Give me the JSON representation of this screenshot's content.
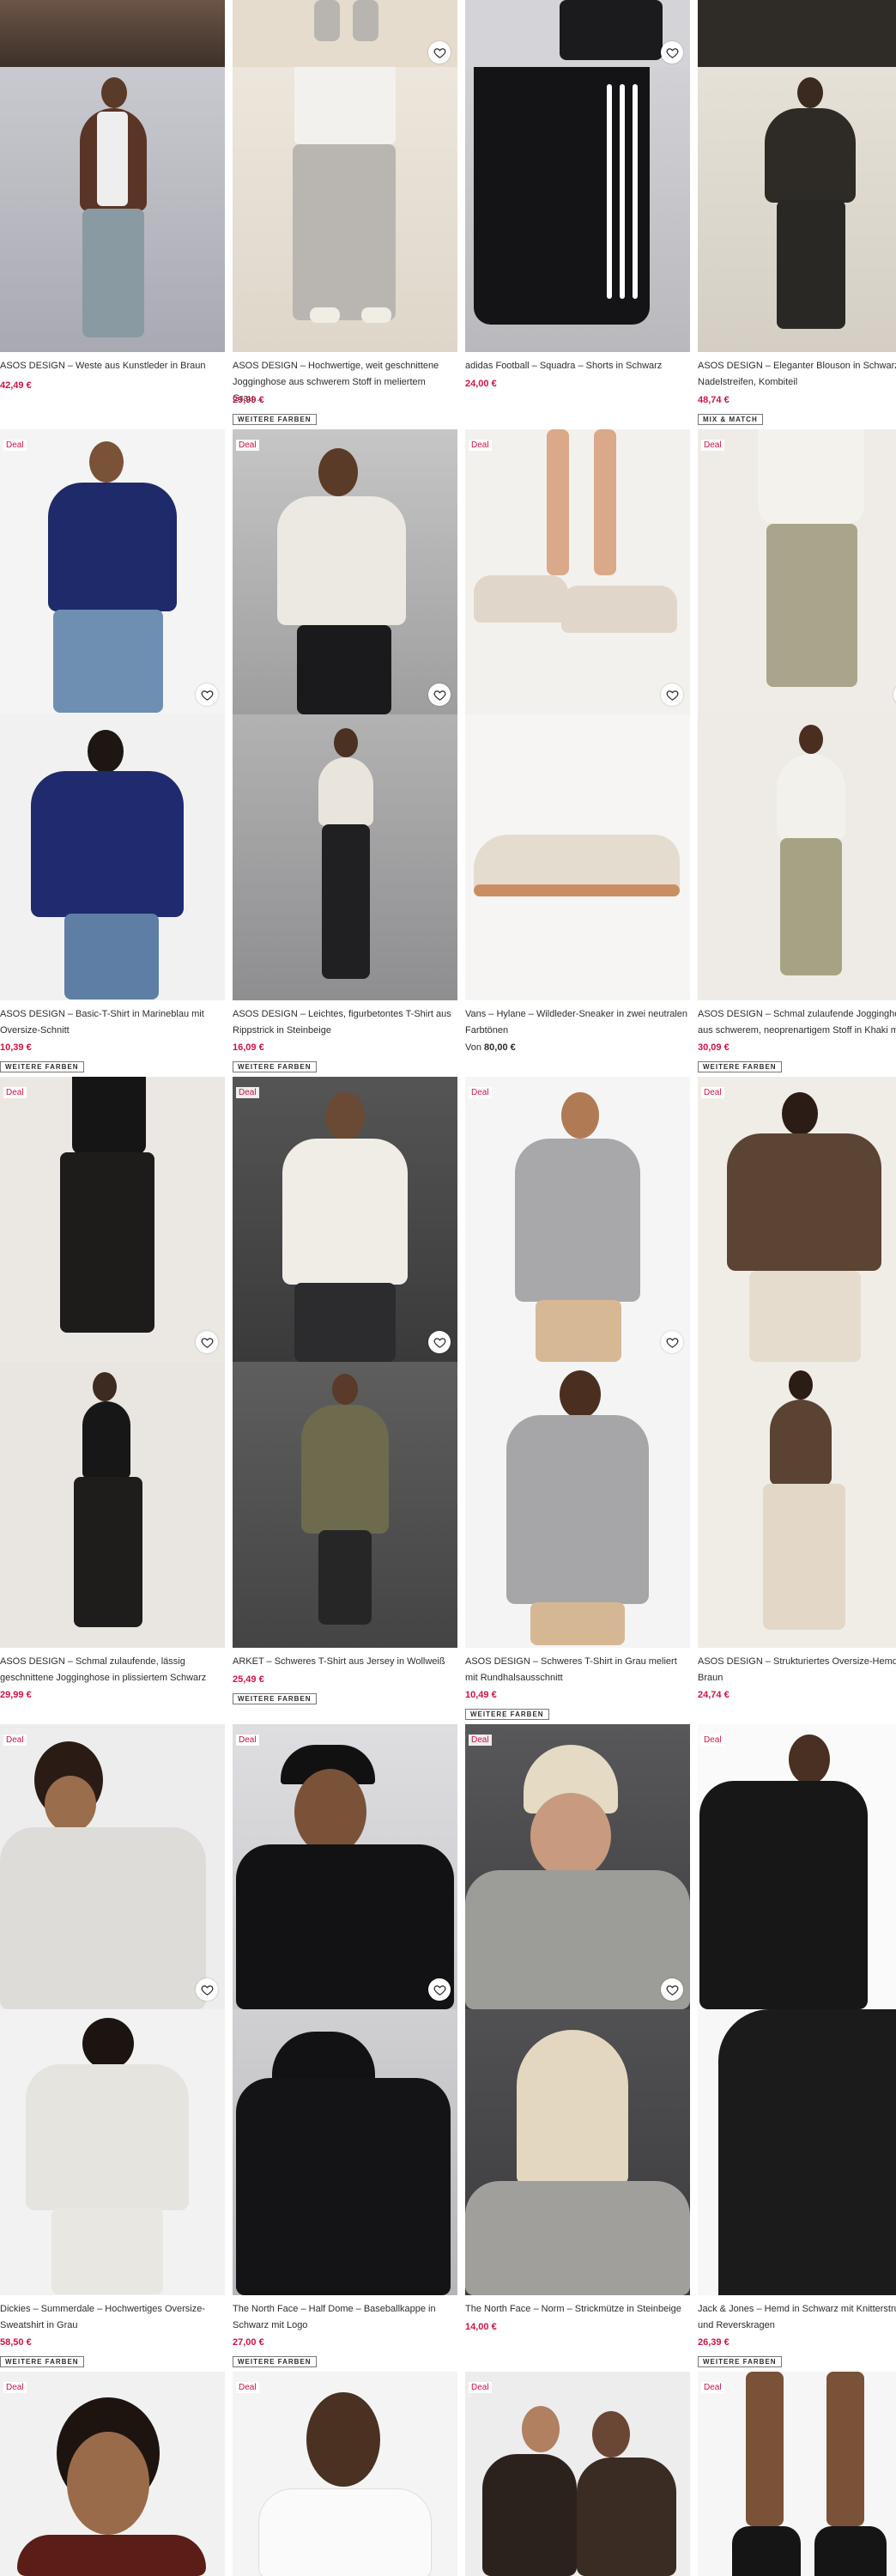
{
  "labels": {
    "deal": "Deal",
    "more_colors": "WEITERE FARBEN",
    "mix_match": "MIX & MATCH",
    "from": "Von"
  },
  "products": [
    {
      "title": "ASOS DESIGN – Weste aus Kunstleder in Braun",
      "price": "42,49 €"
    },
    {
      "title": "ASOS DESIGN – Hochwertige, weit geschnittene Jogginghose aus schwerem Stoff in meliertem Grau…",
      "price": "29,99 €"
    },
    {
      "title": "adidas Football – Squadra – Shorts in Schwarz",
      "price": "24,00 €"
    },
    {
      "title": "ASOS DESIGN – Eleganter Blouson in Schwarz mit Nadelstreifen, Kombiteil",
      "price": "48,74 €"
    },
    {
      "title": "ASOS DESIGN – Basic-T-Shirt in Marineblau mit Oversize-Schnitt",
      "price": "10,39 €"
    },
    {
      "title": "ASOS DESIGN – Leichtes, figurbetontes T-Shirt aus Rippstrick in Steinbeige",
      "price": "16,09 €"
    },
    {
      "title": "Vans – Hylane – Wildleder-Sneaker in zwei neutralen Farbtönen",
      "price": "80,00 €"
    },
    {
      "title": "ASOS DESIGN – Schmal zulaufende Jogginghose aus schwerem, neoprenartigem Stoff in Khaki mit…",
      "price": "30,09 €"
    },
    {
      "title": "ASOS DESIGN – Schmal zulaufende, lässig geschnittene Jogginghose in plissiertem Schwarz",
      "price": "29,99 €"
    },
    {
      "title": "ARKET – Schweres T-Shirt aus Jersey in Wollweiß",
      "price": "25,49 €"
    },
    {
      "title": "ASOS DESIGN – Schweres T-Shirt in Grau meliert mit Rundhalsausschnitt",
      "price": "10,49 €"
    },
    {
      "title": "ASOS DESIGN – Strukturiertes Oversize-Hemd in Braun",
      "price": "24,74 €"
    },
    {
      "title": "Dickies – Summerdale – Hochwertiges Oversize-Sweatshirt in Grau",
      "price": "58,50 €"
    },
    {
      "title": "The North Face – Half Dome – Baseballkappe in Schwarz mit Logo",
      "price": "27,00 €"
    },
    {
      "title": "The North Face – Norm – Strickmütze in Steinbeige",
      "price": "14,00 €"
    },
    {
      "title": "Jack & Jones – Hemd in Schwarz mit Knitterstruktur und Reverskragen",
      "price": "26,39 €"
    }
  ],
  "colors": {
    "price_sale": "#d01345",
    "text": "#2d2d2d"
  }
}
